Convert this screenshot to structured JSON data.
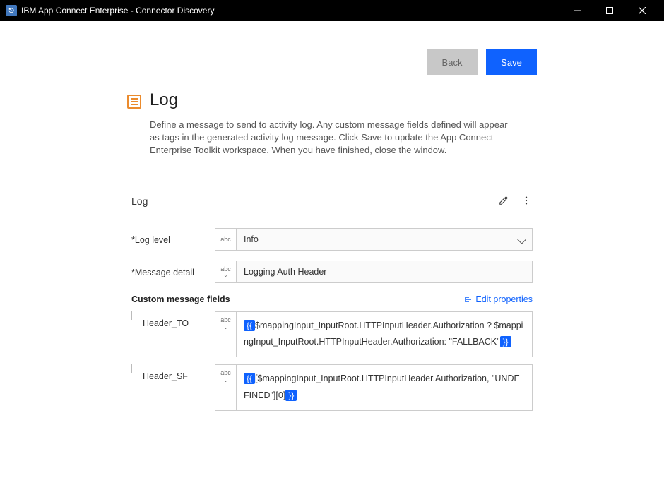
{
  "window": {
    "title": "IBM App Connect Enterprise - Connector Discovery"
  },
  "actions": {
    "back": "Back",
    "save": "Save"
  },
  "page": {
    "title": "Log",
    "description": "Define a message to send to activity log. Any custom message fields defined will appear as tags in the generated activity log message. Click Save to update the App Connect Enterprise Toolkit workspace. When you have finished, close the window."
  },
  "panel": {
    "title": "Log",
    "log_level_label": "Log level",
    "log_level_value": "Info",
    "message_detail_label": "Message detail",
    "message_detail_value": "Logging Auth Header",
    "abc": "abc",
    "custom_fields_heading": "Custom message fields",
    "edit_properties": "Edit properties",
    "fields": [
      {
        "name": "Header_TO",
        "open": "{{",
        "body": "$mappingInput_InputRoot.HTTPInputHeader.Authorization ? $mappingInput_InputRoot.HTTPInputHeader.Authorization: \"FALLBACK\"",
        "close": "}}"
      },
      {
        "name": "Header_SF",
        "open": "{{",
        "body": "[$mappingInput_InputRoot.HTTPInputHeader.Authorization, \"UNDEFINED\"][0]",
        "close": "}}"
      }
    ]
  }
}
